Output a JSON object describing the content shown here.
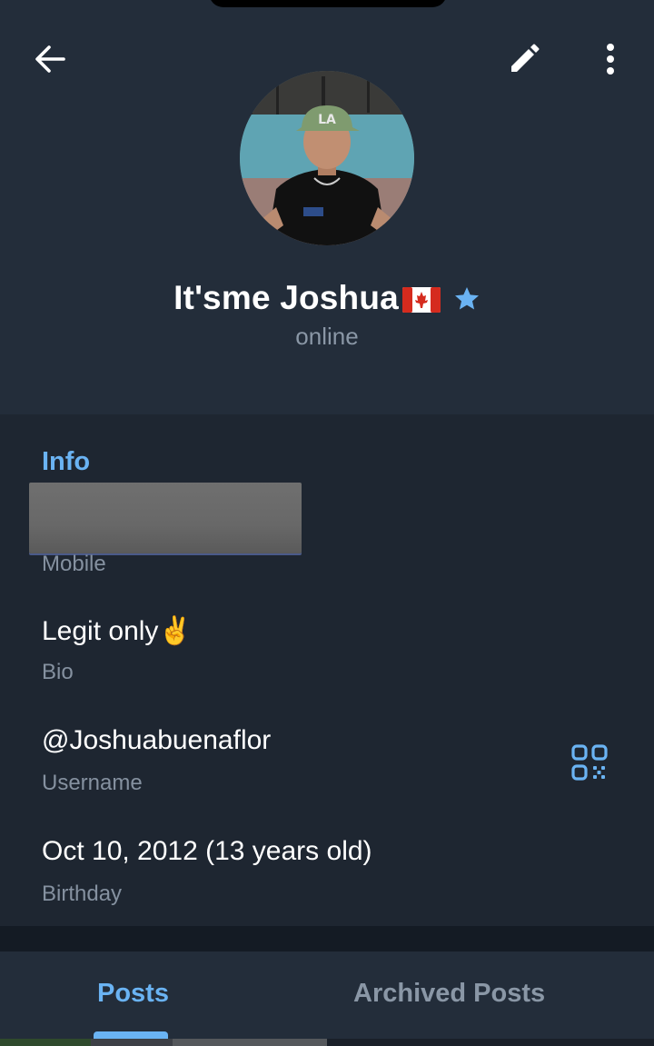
{
  "profile": {
    "name": "It'sme Joshua",
    "name_flag": "Canada flag",
    "status": "online",
    "badge_icon": "star-icon"
  },
  "info": {
    "section_title": "Info",
    "mobile_label": "Mobile",
    "bio_value": "Legit only✌️",
    "bio_label": "Bio",
    "username_value": "@Joshuabuenaflor",
    "username_label": "Username",
    "birthday_value": "Oct 10, 2012 (13 years old)",
    "birthday_label": "Birthday"
  },
  "tabs": [
    {
      "label": "Posts",
      "active": true
    },
    {
      "label": "Archived Posts",
      "active": false
    }
  ],
  "colors": {
    "accent": "#6ab3f3",
    "header_bg": "#232d3a",
    "page_bg": "#1e2631"
  }
}
